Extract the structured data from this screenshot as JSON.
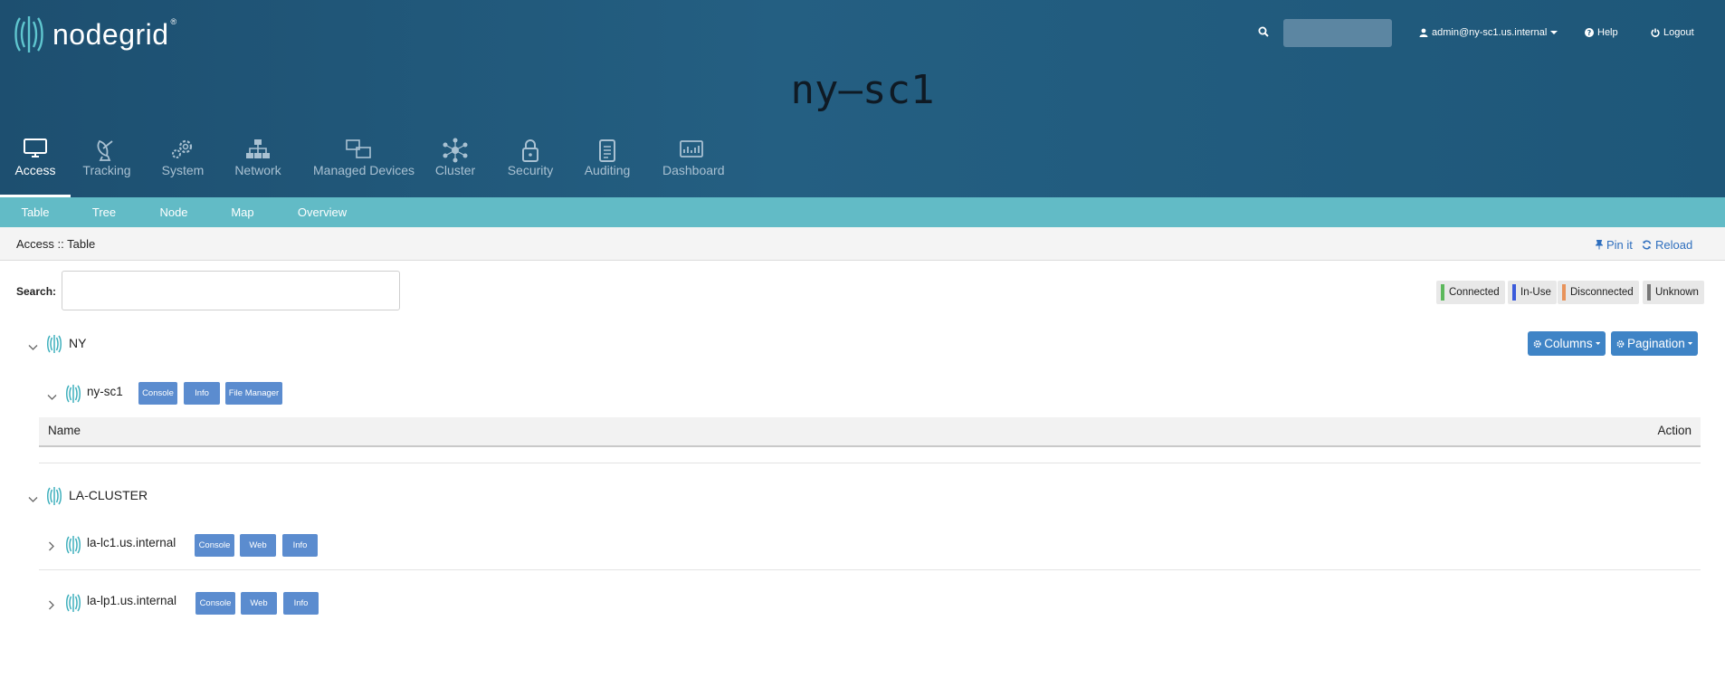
{
  "header": {
    "logo_text": "nodegrid",
    "logo_reg": "®",
    "hostname": "ny–sc1",
    "search_placeholder": "",
    "user": "admin@ny-sc1.us.internal",
    "help": "Help",
    "logout": "Logout"
  },
  "main_nav": [
    {
      "label": "Access",
      "icon": "monitor-icon",
      "active": true
    },
    {
      "label": "Tracking",
      "icon": "satellite-dish-icon"
    },
    {
      "label": "System",
      "icon": "gears-icon"
    },
    {
      "label": "Network",
      "icon": "network-tree-icon"
    },
    {
      "label": "Managed Devices",
      "icon": "devices-icon"
    },
    {
      "label": "Cluster",
      "icon": "cluster-icon"
    },
    {
      "label": "Security",
      "icon": "lock-icon"
    },
    {
      "label": "Auditing",
      "icon": "clipboard-icon"
    },
    {
      "label": "Dashboard",
      "icon": "dashboard-icon"
    }
  ],
  "sub_nav": [
    "Table",
    "Tree",
    "Node",
    "Map",
    "Overview"
  ],
  "breadcrumb": "Access :: Table",
  "actions": {
    "pin": "Pin it",
    "reload": "Reload"
  },
  "search": {
    "label": "Search:",
    "value": ""
  },
  "legend": [
    {
      "label": "Connected",
      "color": "#5cb85c"
    },
    {
      "label": "In-Use",
      "color": "#3b5bdb"
    },
    {
      "label": "Disconnected",
      "color": "#e8935b"
    },
    {
      "label": "Unknown",
      "color": "#777777"
    }
  ],
  "toolbar": {
    "columns": "Columns",
    "pagination": "Pagination"
  },
  "groups": [
    {
      "name": "NY",
      "expanded": true,
      "devices": [
        {
          "name": "ny-sc1",
          "expanded": true,
          "buttons": [
            "Console",
            "Info",
            "File Manager"
          ]
        }
      ],
      "table": {
        "columns": [
          "Name",
          "Action"
        ]
      }
    },
    {
      "name": "LA-CLUSTER",
      "expanded": true,
      "devices": [
        {
          "name": "la-lc1.us.internal",
          "expanded": false,
          "buttons": [
            "Console",
            "Web",
            "Info"
          ]
        },
        {
          "name": "la-lp1.us.internal",
          "expanded": false,
          "buttons": [
            "Console",
            "Web",
            "Info"
          ]
        }
      ]
    }
  ]
}
